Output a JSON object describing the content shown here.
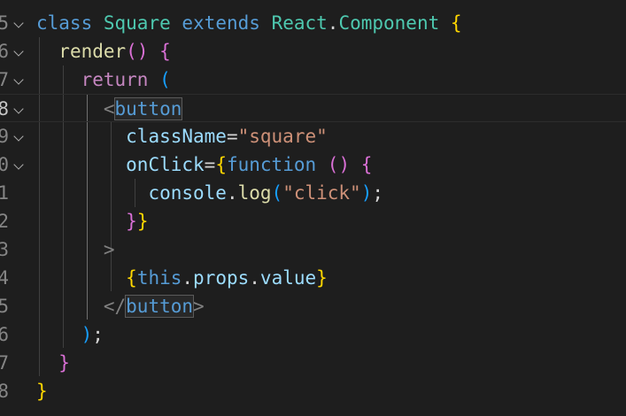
{
  "editor": {
    "colors": {
      "background": "#1e1e1e",
      "keyword": "#569cd6",
      "control": "#c586c0",
      "class": "#4ec9b0",
      "function": "#dcdcaa",
      "attribute": "#9cdcfe",
      "string": "#ce9178",
      "bracket_gold": "#ffd700",
      "bracket_magenta": "#da70d6",
      "bracket_blue": "#179fff"
    },
    "lines": [
      {
        "num": "5",
        "fold": true,
        "tokens": [
          "class",
          "Square",
          "extends",
          "React",
          ".",
          "Component",
          "{"
        ]
      },
      {
        "num": "6",
        "fold": true,
        "tokens": [
          "render",
          "(",
          ")",
          "{"
        ]
      },
      {
        "num": "7",
        "fold": true,
        "tokens": [
          "return",
          "("
        ]
      },
      {
        "num": "8",
        "fold": true,
        "tokens": [
          "<",
          "button"
        ]
      },
      {
        "num": "9",
        "fold": true,
        "tokens": [
          "className",
          "=",
          "\"square\""
        ]
      },
      {
        "num": "0",
        "fold": true,
        "tokens": [
          "onClick",
          "=",
          "{",
          "function",
          "(",
          ")",
          "{"
        ]
      },
      {
        "num": "1",
        "fold": false,
        "tokens": [
          "console",
          ".",
          "log",
          "(",
          "\"click\"",
          ")",
          ";"
        ]
      },
      {
        "num": "2",
        "fold": false,
        "tokens": [
          "}",
          "}"
        ]
      },
      {
        "num": "3",
        "fold": false,
        "tokens": [
          ">"
        ]
      },
      {
        "num": "4",
        "fold": false,
        "tokens": [
          "{",
          "this",
          ".",
          "props",
          ".",
          "value",
          "}"
        ]
      },
      {
        "num": "5",
        "fold": false,
        "tokens": [
          "</",
          "button",
          ">"
        ]
      },
      {
        "num": "6",
        "fold": false,
        "tokens": [
          ")",
          ";"
        ]
      },
      {
        "num": "7",
        "fold": false,
        "tokens": [
          "}"
        ]
      },
      {
        "num": "8",
        "fold": false,
        "tokens": [
          "}"
        ]
      }
    ]
  }
}
